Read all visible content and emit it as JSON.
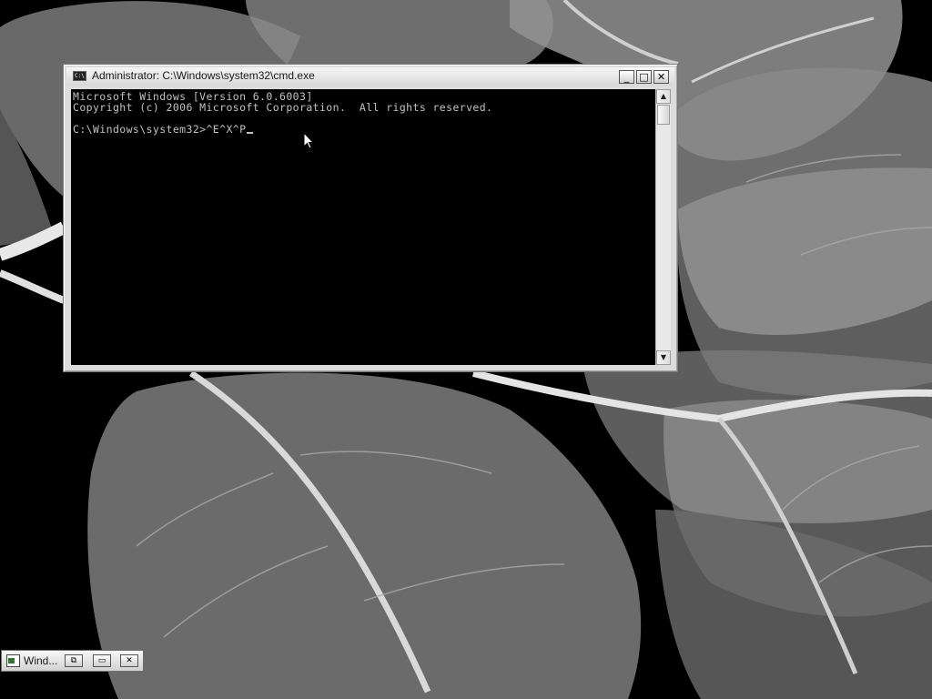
{
  "desktop": {
    "wallpaper": "grayscale leaf x-ray"
  },
  "cmd_window": {
    "title": "Administrator: C:\\Windows\\system32\\cmd.exe",
    "icon": "cmd-icon",
    "icon_label": "C:\\",
    "buttons": {
      "minimize": "_",
      "maximize": "□",
      "close": "✕"
    },
    "console_lines": [
      "Microsoft Windows [Version 6.0.6003]",
      "Copyright (c) 2006 Microsoft Corporation.  All rights reserved.",
      "C:\\Windows\\system32>^E^X^P"
    ]
  },
  "minimized_window": {
    "title": "Wind...",
    "buttons": {
      "restore": "⧉",
      "maximize": "▭",
      "close": "✕"
    }
  },
  "colors": {
    "console_bg": "#000000",
    "console_text": "#c0c0c0",
    "desktop_bg": "#000000"
  }
}
